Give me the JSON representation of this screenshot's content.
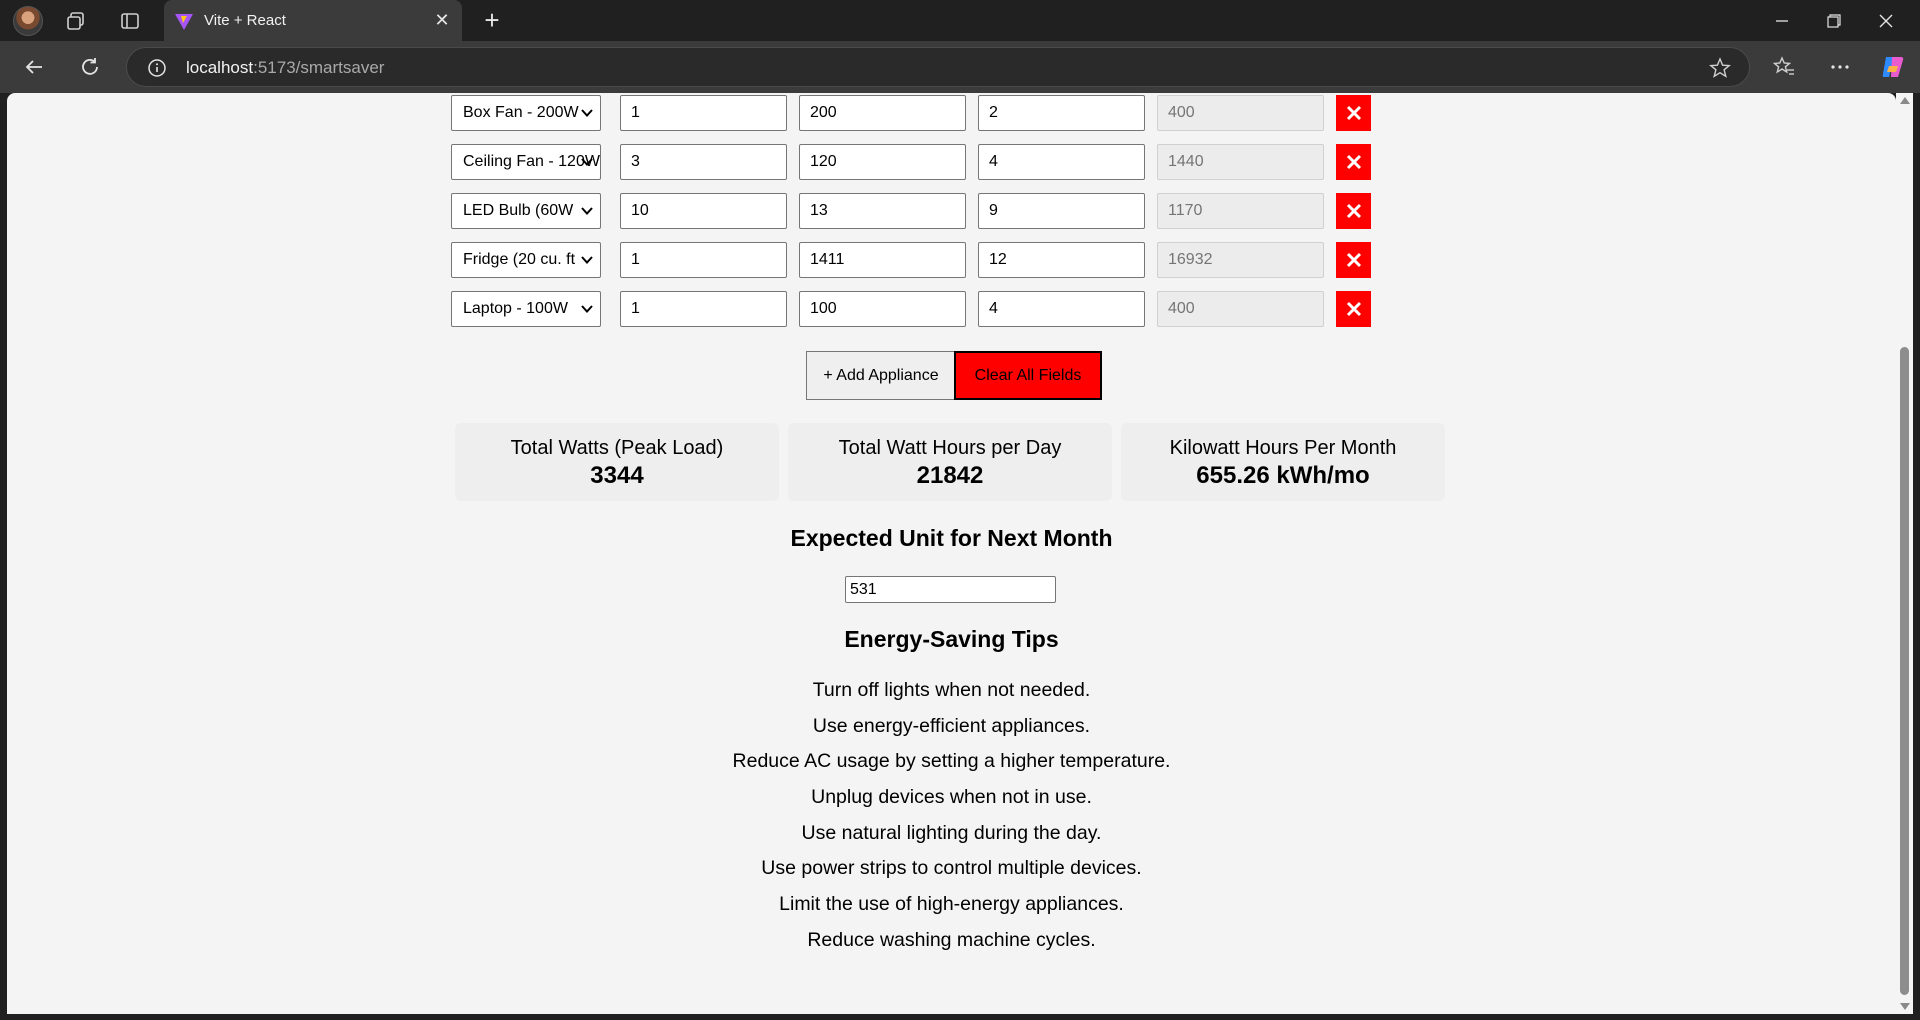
{
  "browser": {
    "tab_title": "Vite + React",
    "url_host": "localhost",
    "url_rest": ":5173/smartsaver"
  },
  "appliances": [
    {
      "name": "Box Fan - 200W",
      "quantity": "1",
      "watts": "200",
      "hours": "2",
      "watt_hours": "400"
    },
    {
      "name": "Ceiling Fan - 120W",
      "quantity": "3",
      "watts": "120",
      "hours": "4",
      "watt_hours": "1440"
    },
    {
      "name": "LED Bulb (60W",
      "quantity": "10",
      "watts": "13",
      "hours": "9",
      "watt_hours": "1170"
    },
    {
      "name": "Fridge (20 cu. ft",
      "quantity": "1",
      "watts": "1411",
      "hours": "12",
      "watt_hours": "16932"
    },
    {
      "name": "Laptop - 100W",
      "quantity": "1",
      "watts": "100",
      "hours": "4",
      "watt_hours": "400"
    }
  ],
  "actions": {
    "add_label": "+ Add Appliance",
    "clear_label": "Clear All Fields"
  },
  "summary": {
    "peak_label": "Total Watts (Peak Load)",
    "peak_value": "3344",
    "daily_label": "Total Watt Hours per Day",
    "daily_value": "21842",
    "monthly_label": "Kilowatt Hours Per Month",
    "monthly_value": "655.26 kWh/mo"
  },
  "expected": {
    "heading": "Expected Unit for Next Month",
    "value": "531"
  },
  "tips": {
    "heading": "Energy-Saving Tips",
    "items": [
      "Turn off lights when not needed.",
      "Use energy-efficient appliances.",
      "Reduce AC usage by setting a higher temperature.",
      "Unplug devices when not in use.",
      "Use natural lighting during the day.",
      "Use power strips to control multiple devices.",
      "Limit the use of high-energy appliances.",
      "Reduce washing machine cycles."
    ]
  },
  "colors": {
    "delete_button": "#ff0000",
    "clear_button": "#ff0000",
    "page_background": "#f4f4f4"
  }
}
